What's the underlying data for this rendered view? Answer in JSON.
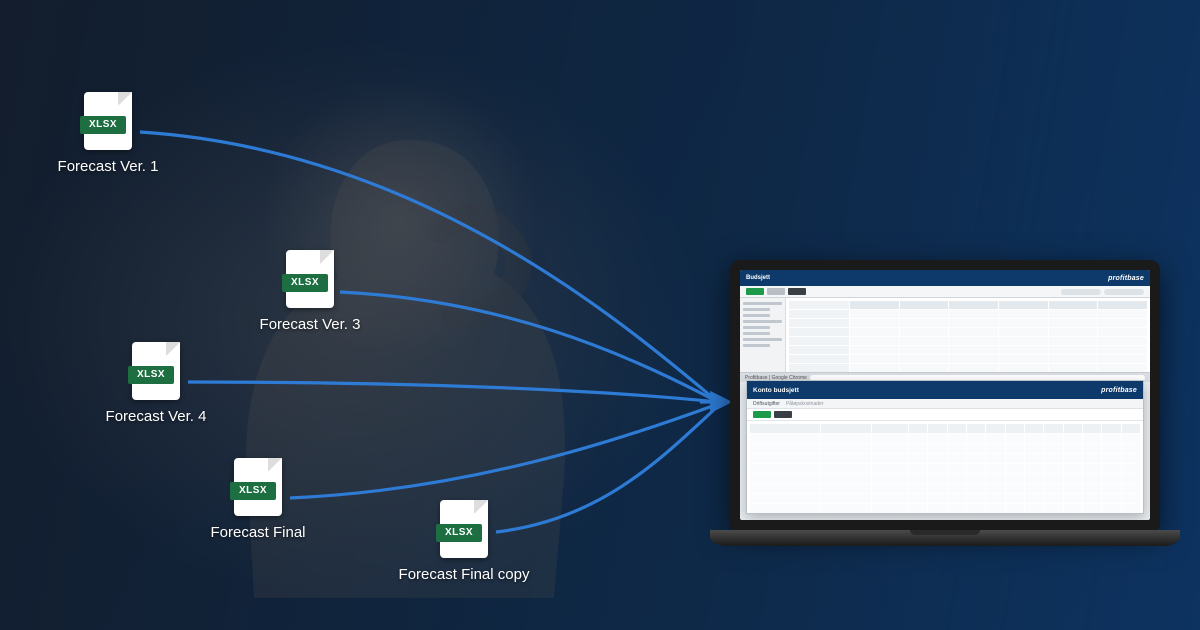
{
  "icon_badge": "XLSX",
  "files": [
    {
      "label": "Forecast Ver. 1"
    },
    {
      "label": "Forecast Ver. 3"
    },
    {
      "label": "Forecast Ver. 4"
    },
    {
      "label": "Forecast Final"
    },
    {
      "label": "Forecast Final copy"
    }
  ],
  "app": {
    "brand": "profitbase",
    "title_main": "Budsjett",
    "title_window2": "Konto budsjett",
    "tabs": {
      "a": "Driftsutgifter",
      "b": "Påløpskostnader"
    },
    "address_hint": "Profitbase | Google Chrome"
  }
}
